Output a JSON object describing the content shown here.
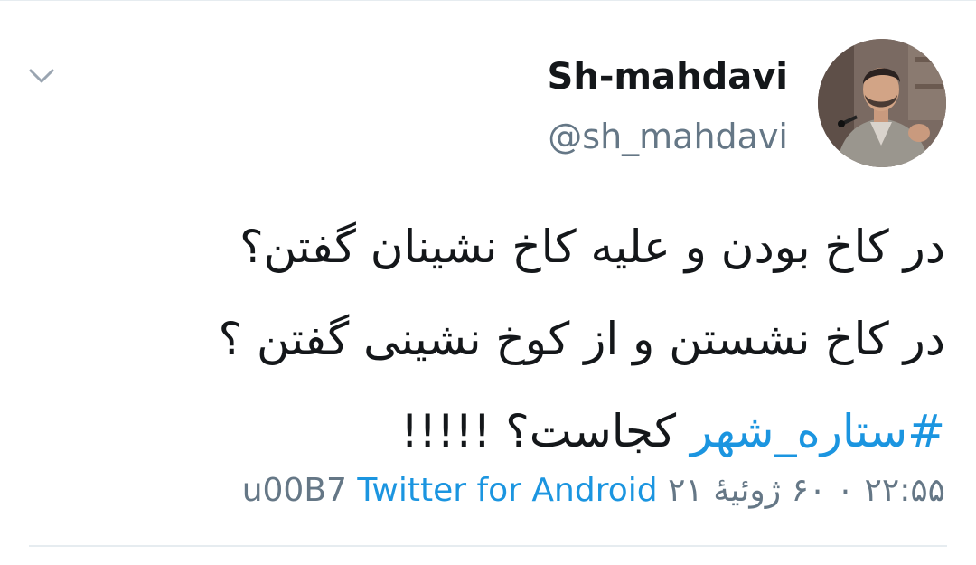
{
  "tweet": {
    "author": {
      "display_name": "Sh-mahdavi",
      "handle": "@sh_mahdavi",
      "avatar_icon": "person-speaking-photo"
    },
    "menu_icon": "chevron-down-icon",
    "body_lines": [
      "در کاخ بودن و علیه کاخ نشینان گفتن؟",
      "در کاخ نشستن و از کوخ نشینی گفتن ؟"
    ],
    "hashtag": "#ستاره_شهر",
    "last_line_rest": "کجاست؟ !!!!!",
    "timestamp": "۲۲:۵۵ ۰ ۶۰ ژوئیهٔ ۲۱",
    "separator": "u00B7",
    "source": "Twitter for Android"
  },
  "colors": {
    "text": "#14171a",
    "secondary": "#657786",
    "link": "#1b95e0",
    "divider": "#e6ecf0"
  }
}
